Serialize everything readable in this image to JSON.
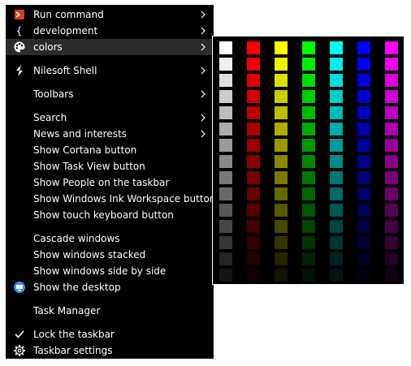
{
  "menu": {
    "items": [
      {
        "label": "Run command",
        "icon": "powershell-icon",
        "submenu": true
      },
      {
        "label": "development",
        "icon": "braces-icon",
        "submenu": true
      },
      {
        "label": "colors",
        "icon": "palette-icon",
        "submenu": true,
        "highlighted": true
      },
      {
        "label": "Nilesoft Shell",
        "icon": "nilesoft-logo-icon",
        "submenu": true
      },
      {
        "label": "Toolbars",
        "submenu": true
      },
      {
        "label": "Search",
        "submenu": true
      },
      {
        "label": "News and interests",
        "submenu": true
      },
      {
        "label": "Show Cortana button"
      },
      {
        "label": "Show Task View button"
      },
      {
        "label": "Show People on the taskbar"
      },
      {
        "label": "Show Windows Ink Workspace button"
      },
      {
        "label": "Show touch keyboard button"
      },
      {
        "label": "Cascade windows"
      },
      {
        "label": "Show windows stacked"
      },
      {
        "label": "Show windows side by side"
      },
      {
        "label": "Show the desktop",
        "icon": "desktop-icon"
      },
      {
        "label": "Task Manager"
      },
      {
        "label": "Lock the taskbar",
        "icon": "checkmark-icon"
      },
      {
        "label": "Taskbar settings",
        "icon": "gear-icon"
      }
    ]
  },
  "palette": {
    "hues": [
      "#ffffff",
      "#ff0000",
      "#ffff00",
      "#00ff00",
      "#00ffff",
      "#0000ff",
      "#ff00ff"
    ],
    "rows": 15
  },
  "colors": {
    "menu_background": "#000000",
    "highlight": "#2b2b2b",
    "text": "#ffffff",
    "powershell_icon": "#d23f1f",
    "desktop_icon": "#3a8ee6"
  }
}
